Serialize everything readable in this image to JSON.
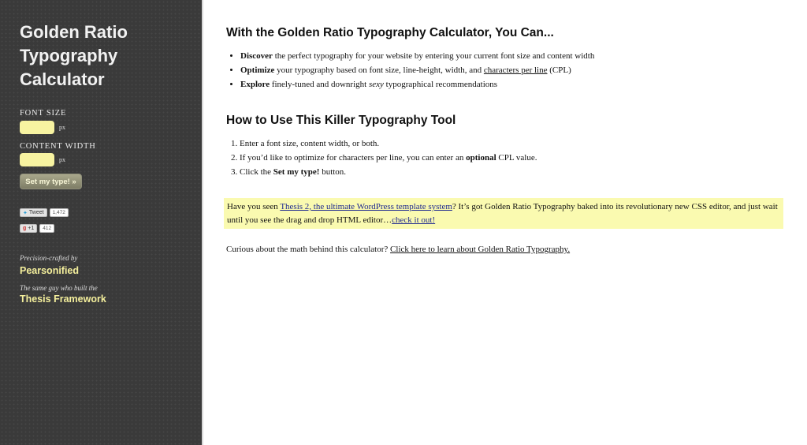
{
  "sidebar": {
    "title": "Golden Ratio Typography Calculator",
    "font_size_label": "FONT SIZE",
    "content_width_label": "CONTENT WIDTH",
    "unit": "px",
    "font_size_value": "",
    "content_width_value": "",
    "set_button": "Set my type! »",
    "social": {
      "tweet_label": "Tweet",
      "tweet_count": "1,472",
      "gplus_label": "+1",
      "gplus_count": "412"
    },
    "crafted_by": "Precision-crafted by",
    "author": "Pearsonified",
    "built": "The same guy who built the",
    "framework": "Thesis Framework"
  },
  "main": {
    "heading1": "With the Golden Ratio Typography Calculator, You Can...",
    "features": [
      {
        "bold": "Discover",
        "text": " the perfect typography for your website by entering your current font size and content width"
      },
      {
        "bold": "Optimize",
        "text": " your typography based on font size, line-height, width, and ",
        "link": "characters per line",
        "after": " (CPL)"
      },
      {
        "bold": "Explore",
        "text": " finely-tuned and downright ",
        "italic": "sexy",
        "after": " typographical recommendations"
      }
    ],
    "heading2": "How to Use This Killer Typography Tool",
    "steps": [
      {
        "text": "Enter a font size, content width, or both."
      },
      {
        "text": "If you’d like to optimize for characters per line, you can enter an ",
        "bold": "optional",
        "after": " CPL value."
      },
      {
        "text": "Click the ",
        "bold": "Set my type!",
        "after": " button."
      }
    ],
    "promo": {
      "before": "Have you seen ",
      "link1": "Thesis 2, the ultimate WordPress template system",
      "middle": "? It’s got Golden Ratio Typography baked into its revolutionary new CSS editor, and just wait until you see the drag and drop HTML editor…",
      "link2": "check it out!"
    },
    "curious": {
      "text": "Curious about the math behind this calculator? ",
      "link": "Click here to learn about Golden Ratio Typography."
    }
  },
  "colors": {
    "sidebar_bg": "#3a3a3a",
    "input_bg": "#f7f3a1",
    "promo_bg": "#fafab0",
    "link_blue": "#1f2a8f",
    "accent_yellow": "#f4ef9c"
  }
}
